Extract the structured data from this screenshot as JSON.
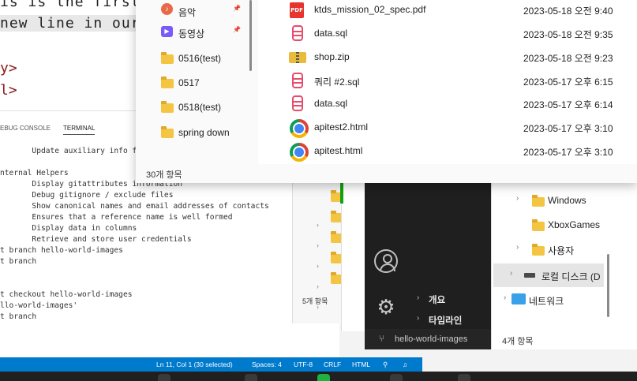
{
  "editor": {
    "line1": "is is the first",
    "line2": "new line in our",
    "line3": "y>",
    "line4": "l>"
  },
  "panel": {
    "tab_debug": "EBUG CONSOLE",
    "tab_terminal": "TERMINAL",
    "terminal_lines": [
      "       Update auxiliary info fil",
      "",
      "nternal Helpers",
      "       Display gitattributes information",
      "       Debug gitignore / exclude files",
      "       Show canonical names and email addresses of contacts",
      "       Ensures that a reference name is well formed",
      "       Display data in columns",
      "       Retrieve and store user credentials",
      "t branch hello-world-images",
      "t branch",
      "",
      "",
      "t checkout hello-world-images",
      "llo-world-images'",
      "t branch"
    ]
  },
  "statusbar": {
    "position": "Ln 11, Col 1 (30 selected)",
    "spaces": "Spaces: 4",
    "encoding": "UTF-8",
    "eol": "CRLF",
    "language": "HTML"
  },
  "explorer": {
    "nav_items": [
      {
        "label": "음악",
        "icon": "music-icon",
        "pinned": true
      },
      {
        "label": "동영상",
        "icon": "video-icon",
        "pinned": true
      },
      {
        "label": "0516(test)",
        "icon": "folder-icon",
        "pinned": false
      },
      {
        "label": "0517",
        "icon": "folder-icon",
        "pinned": false
      },
      {
        "label": "0518(test)",
        "icon": "folder-icon",
        "pinned": false
      },
      {
        "label": "spring down",
        "icon": "folder-icon",
        "pinned": false
      }
    ],
    "item_count": "30개 항목",
    "files": [
      {
        "name": "ktds_mission_02_spec.pdf",
        "date": "2023-05-18 오전 9:40",
        "icon": "pdf-icon"
      },
      {
        "name": "data.sql",
        "date": "2023-05-18 오전 9:35",
        "icon": "sql-icon"
      },
      {
        "name": "shop.zip",
        "date": "2023-05-18 오전 9:23",
        "icon": "zip-icon"
      },
      {
        "name": "쿼리 #2.sql",
        "date": "2023-05-17 오후 6:15",
        "icon": "sql-icon"
      },
      {
        "name": "data.sql",
        "date": "2023-05-17 오후 6:14",
        "icon": "sql-icon"
      },
      {
        "name": "apitest2.html",
        "date": "2023-05-17 오후 3:10",
        "icon": "chrome-icon"
      },
      {
        "name": "apitest.html",
        "date": "2023-05-17 오후 3:10",
        "icon": "chrome-icon"
      }
    ]
  },
  "back_window": {
    "item_count": "5개 항목"
  },
  "settings": {
    "items": [
      "개요",
      "타임라인"
    ],
    "branch": "hello-world-images"
  },
  "explorer2": {
    "items": [
      {
        "label": "Windows",
        "icon": "folder-icon"
      },
      {
        "label": "XboxGames",
        "icon": "folder-icon"
      },
      {
        "label": "사용자",
        "icon": "folder-icon"
      },
      {
        "label": "로컬 디스크 (D",
        "icon": "drive-icon"
      },
      {
        "label": "네트워크",
        "icon": "network-icon"
      }
    ],
    "item_count": "4개 항목"
  }
}
